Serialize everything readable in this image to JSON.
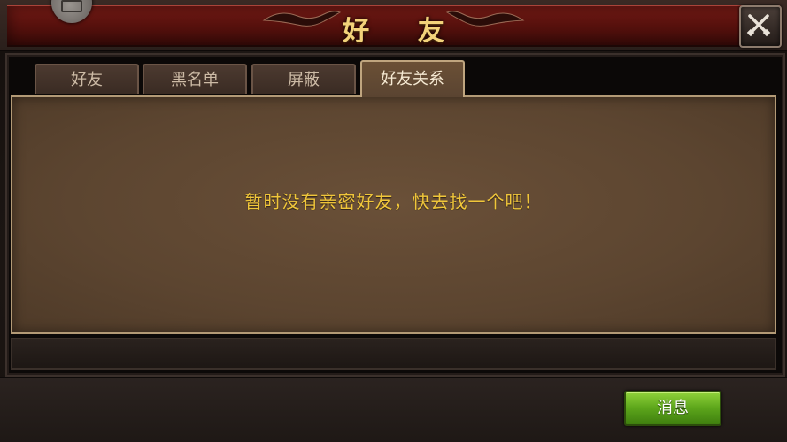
{
  "window": {
    "title": "好 友"
  },
  "tabs": [
    {
      "label": "好友",
      "active": false
    },
    {
      "label": "黑名单",
      "active": false
    },
    {
      "label": "屏蔽",
      "active": false
    },
    {
      "label": "好友关系",
      "active": true
    }
  ],
  "content": {
    "empty_message": "暂时没有亲密好友，快去找一个吧！"
  },
  "footer": {
    "messages_button_label": "消息"
  },
  "icons": {
    "close": "close-crossed-swords-icon",
    "corner": "badge-icon"
  },
  "colors": {
    "title_band": "#5a120e",
    "title_text": "#f3d27a",
    "message_text": "#f0c63a",
    "button_green": "#5da61b"
  }
}
